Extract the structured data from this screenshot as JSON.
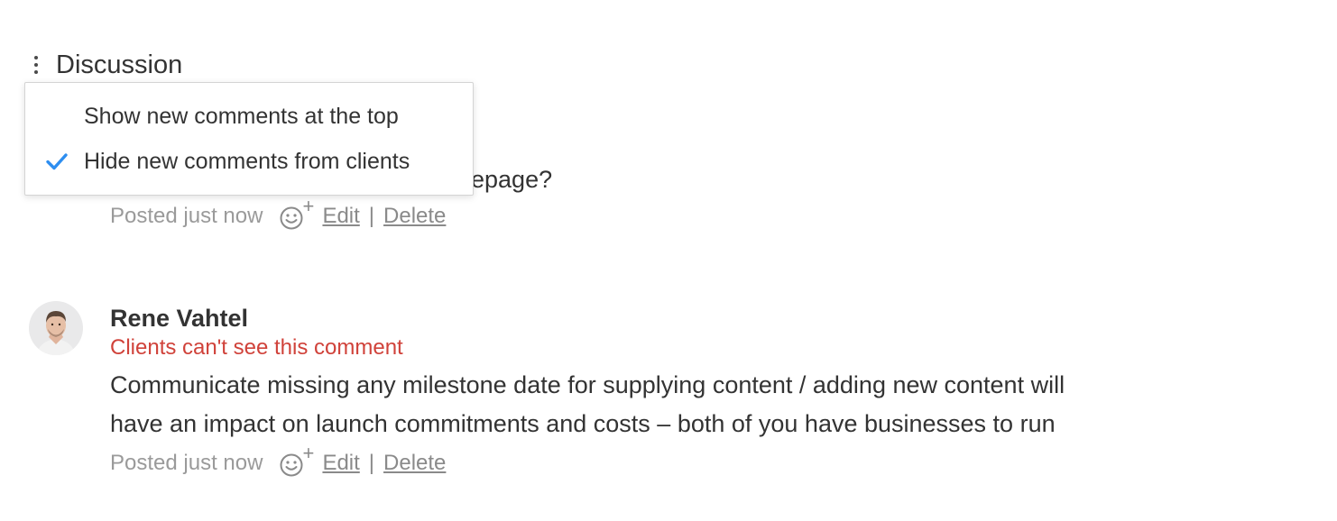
{
  "discussion": {
    "title": "Discussion"
  },
  "dropdown": {
    "items": [
      {
        "label": "Show new comments at the top",
        "checked": false
      },
      {
        "label": "Hide new comments from clients",
        "checked": true
      }
    ],
    "check_color": "#2e8ef0"
  },
  "comments": [
    {
      "text_visible": "epage?",
      "posted": "Posted just now",
      "edit_label": "Edit",
      "separator": "|",
      "delete_label": "Delete"
    },
    {
      "author": "Rene Vahtel",
      "visibility_note": "Clients can't see this comment",
      "text_line1": "Communicate missing any milestone date for supplying content / adding new content will",
      "text_line2": "have an impact on launch commitments and costs – both of you have businesses to run",
      "posted": "Posted just now",
      "edit_label": "Edit",
      "separator": "|",
      "delete_label": "Delete"
    }
  ],
  "colors": {
    "visibility_note": "#d0423a",
    "meta_text": "#9a9a9a"
  },
  "icons": {
    "menu": "kebab-vertical-icon",
    "reaction": "smiley-plus-icon",
    "checked": "checkmark-icon"
  }
}
